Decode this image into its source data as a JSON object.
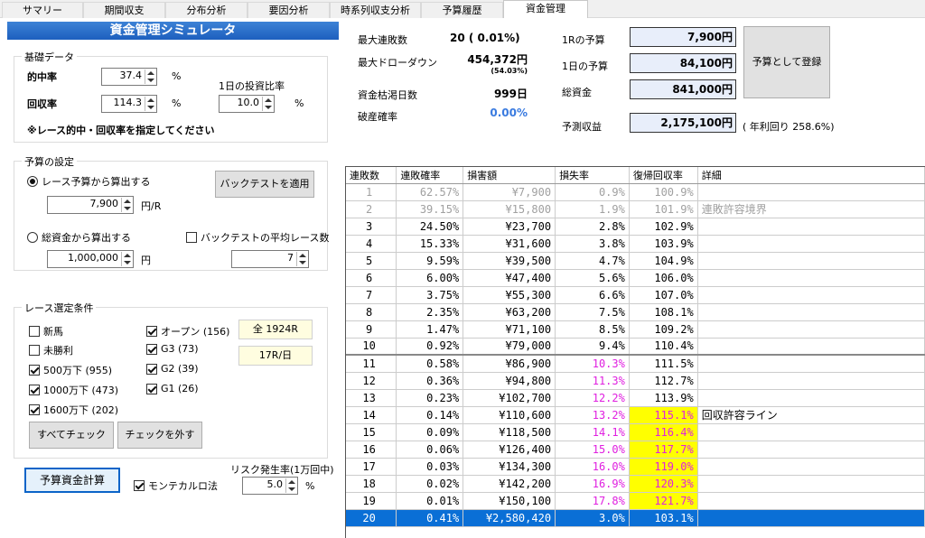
{
  "tabs": [
    "サマリー",
    "期間収支",
    "分布分析",
    "要因分析",
    "時系列収支分析",
    "予算履歴",
    "資金管理"
  ],
  "title": "資金管理シミュレータ",
  "basic": {
    "group": "基礎データ",
    "hit_label": "的中率",
    "hit_value": "37.4",
    "hit_unit": "%",
    "return_label": "回収率",
    "return_value": "114.3",
    "return_unit": "%",
    "invest_label": "1日の投資比率",
    "invest_value": "10.0",
    "invest_unit": "%",
    "note": "※レース的中・回収率を指定してください"
  },
  "budget": {
    "group": "予算の設定",
    "radio1": "レース予算から算出する",
    "race_budget": "7,900",
    "race_unit": "円/R",
    "backtest_btn": "バックテストを適用",
    "radio2": "総資金から算出する",
    "total": "1,000,000",
    "total_unit": "円",
    "avg_label": "バックテストの平均レース数",
    "avg_value": "7"
  },
  "race": {
    "group": "レース選定条件",
    "items": [
      {
        "label": "新馬",
        "checked": false
      },
      {
        "label": "未勝利",
        "checked": false
      },
      {
        "label": "500万下 (955)",
        "checked": true
      },
      {
        "label": "1000万下 (473)",
        "checked": true
      },
      {
        "label": "1600万下 (202)",
        "checked": true
      },
      {
        "label": "オープン (156)",
        "checked": true
      },
      {
        "label": "G3 (73)",
        "checked": true
      },
      {
        "label": "G2 (39)",
        "checked": true
      },
      {
        "label": "G1 (26)",
        "checked": true
      }
    ],
    "info1": "全 1924R",
    "info2": "17R/日",
    "check_all": "すべてチェック",
    "uncheck": "チェックを外す"
  },
  "calc_button": "予算資金計算",
  "monte": {
    "label": "モンテカルロ法",
    "checked": true
  },
  "risk": {
    "label": "リスク発生率(1万回中)",
    "value": "5.0",
    "unit": "%"
  },
  "stats": {
    "max_losing_label": "最大連敗数",
    "max_losing": "20 ( 0.01%)",
    "max_dd_label": "最大ドローダウン",
    "max_dd": "454,372円",
    "max_dd_pct": "(54.03%)",
    "depletion_label": "資金枯渇日数",
    "depletion": "999日",
    "ruin_label": "破産確率",
    "ruin": "0.00%"
  },
  "budgets": {
    "per_race_label": "1Rの予算",
    "per_race": "7,900円",
    "per_day_label": "1日の予算",
    "per_day": "84,100円",
    "total_label": "総資金",
    "total": "841,000円",
    "register_btn": "予算として登録",
    "profit_label": "予測収益",
    "profit": "2,175,100円",
    "profit_note": "( 年利回り 258.6%)"
  },
  "table": {
    "headers": [
      "連敗数",
      "連敗確率",
      "損害額",
      "損失率",
      "復帰回収率",
      "詳細"
    ],
    "rows": [
      {
        "n": "1",
        "p": "62.57%",
        "loss": "¥7,900",
        "rate": "0.9%",
        "rec": "100.9%",
        "d": ""
      },
      {
        "n": "2",
        "p": "39.15%",
        "loss": "¥15,800",
        "rate": "1.9%",
        "rec": "101.9%",
        "d": "連敗許容境界"
      },
      {
        "n": "3",
        "p": "24.50%",
        "loss": "¥23,700",
        "rate": "2.8%",
        "rec": "102.9%",
        "d": ""
      },
      {
        "n": "4",
        "p": "15.33%",
        "loss": "¥31,600",
        "rate": "3.8%",
        "rec": "103.9%",
        "d": ""
      },
      {
        "n": "5",
        "p": "9.59%",
        "loss": "¥39,500",
        "rate": "4.7%",
        "rec": "104.9%",
        "d": ""
      },
      {
        "n": "6",
        "p": "6.00%",
        "loss": "¥47,400",
        "rate": "5.6%",
        "rec": "106.0%",
        "d": ""
      },
      {
        "n": "7",
        "p": "3.75%",
        "loss": "¥55,300",
        "rate": "6.6%",
        "rec": "107.0%",
        "d": ""
      },
      {
        "n": "8",
        "p": "2.35%",
        "loss": "¥63,200",
        "rate": "7.5%",
        "rec": "108.1%",
        "d": ""
      },
      {
        "n": "9",
        "p": "1.47%",
        "loss": "¥71,100",
        "rate": "8.5%",
        "rec": "109.2%",
        "d": ""
      },
      {
        "n": "10",
        "p": "0.92%",
        "loss": "¥79,000",
        "rate": "9.4%",
        "rec": "110.4%",
        "d": ""
      },
      {
        "n": "11",
        "p": "0.58%",
        "loss": "¥86,900",
        "rate": "10.3%",
        "rec": "111.5%",
        "d": ""
      },
      {
        "n": "12",
        "p": "0.36%",
        "loss": "¥94,800",
        "rate": "11.3%",
        "rec": "112.7%",
        "d": ""
      },
      {
        "n": "13",
        "p": "0.23%",
        "loss": "¥102,700",
        "rate": "12.2%",
        "rec": "113.9%",
        "d": ""
      },
      {
        "n": "14",
        "p": "0.14%",
        "loss": "¥110,600",
        "rate": "13.2%",
        "rec": "115.1%",
        "d": "回収許容ライン"
      },
      {
        "n": "15",
        "p": "0.09%",
        "loss": "¥118,500",
        "rate": "14.1%",
        "rec": "116.4%",
        "d": ""
      },
      {
        "n": "16",
        "p": "0.06%",
        "loss": "¥126,400",
        "rate": "15.0%",
        "rec": "117.7%",
        "d": ""
      },
      {
        "n": "17",
        "p": "0.03%",
        "loss": "¥134,300",
        "rate": "16.0%",
        "rec": "119.0%",
        "d": ""
      },
      {
        "n": "18",
        "p": "0.02%",
        "loss": "¥142,200",
        "rate": "16.9%",
        "rec": "120.3%",
        "d": ""
      },
      {
        "n": "19",
        "p": "0.01%",
        "loss": "¥150,100",
        "rate": "17.8%",
        "rec": "121.7%",
        "d": ""
      },
      {
        "n": "20",
        "p": "0.41%",
        "loss": "¥2,580,420",
        "rate": "3.0%",
        "rec": "103.1%",
        "d": ""
      }
    ]
  }
}
